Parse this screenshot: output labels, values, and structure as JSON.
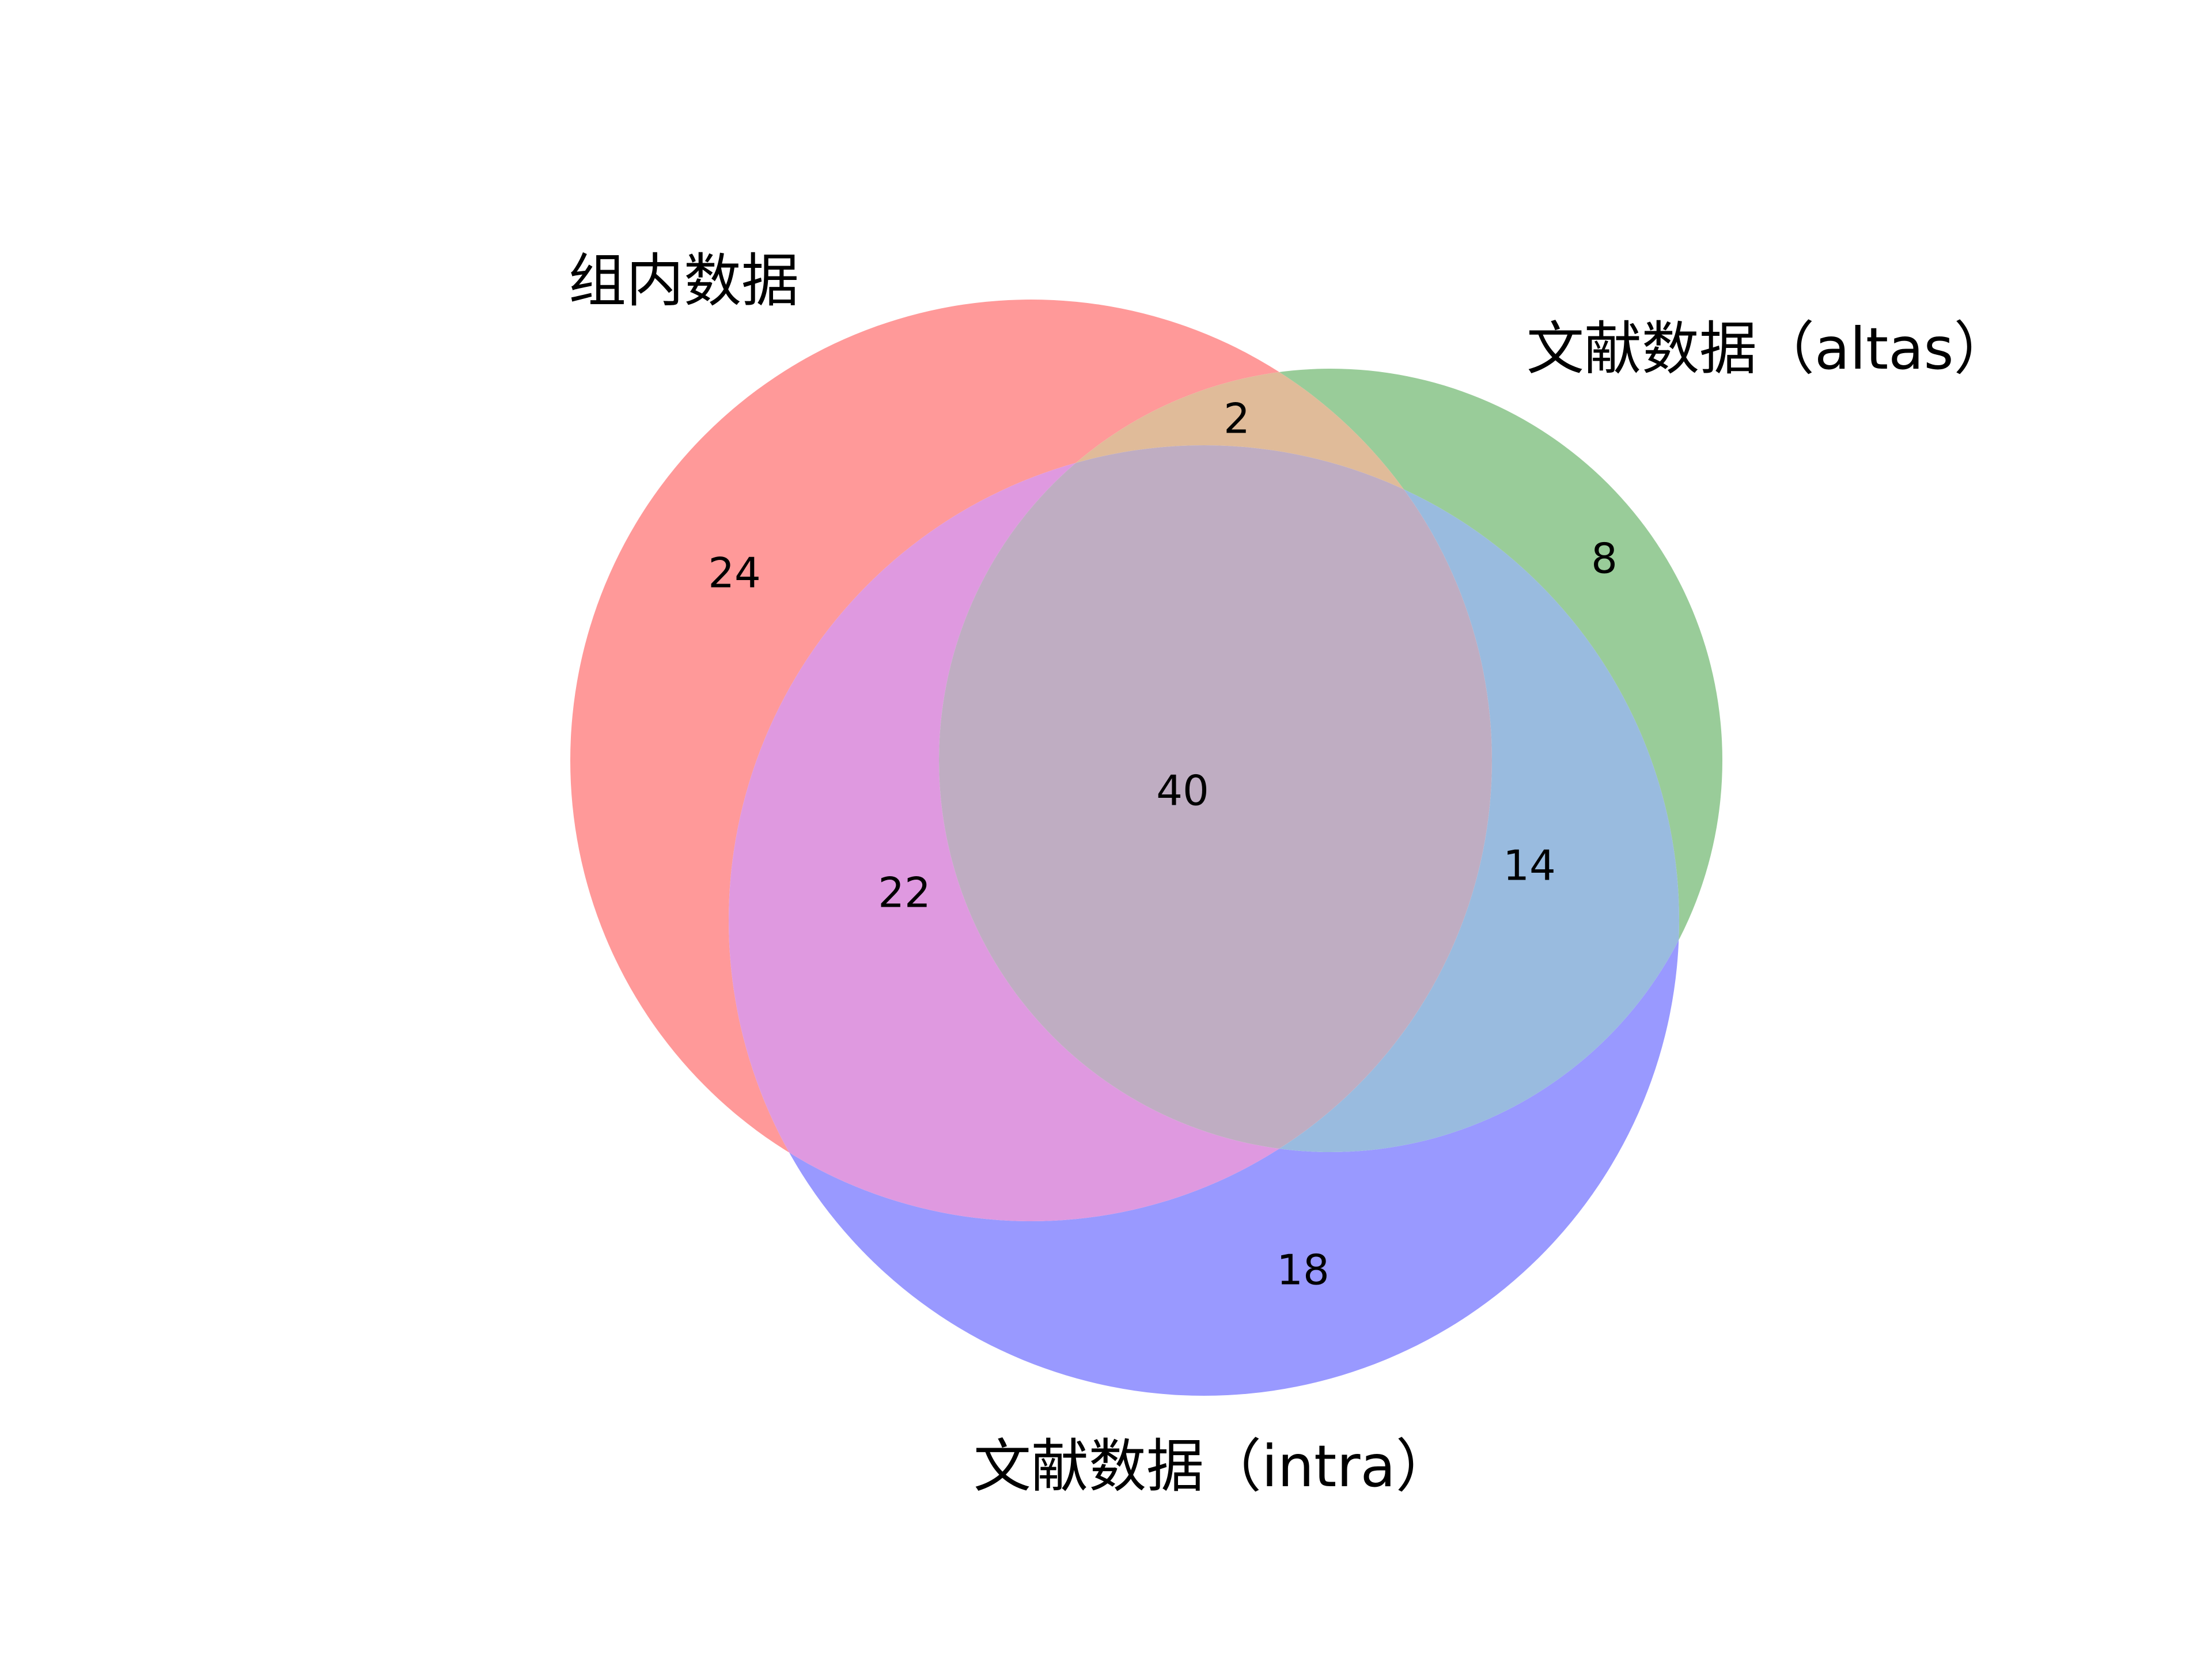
{
  "sets": [
    {
      "id": "A",
      "label": "组内数据",
      "color": "#ff9999"
    },
    {
      "id": "B",
      "label": "文献数据（altas）",
      "color": "#99cc99"
    },
    {
      "id": "C",
      "label": "文献数据（intra）",
      "color": "#9999ff"
    }
  ],
  "regions": {
    "A_only": "24",
    "B_only": "8",
    "C_only": "18",
    "A_and_B_only": "2",
    "A_and_C_only": "22",
    "B_and_C_only": "14",
    "A_and_B_and_C": "40"
  }
}
